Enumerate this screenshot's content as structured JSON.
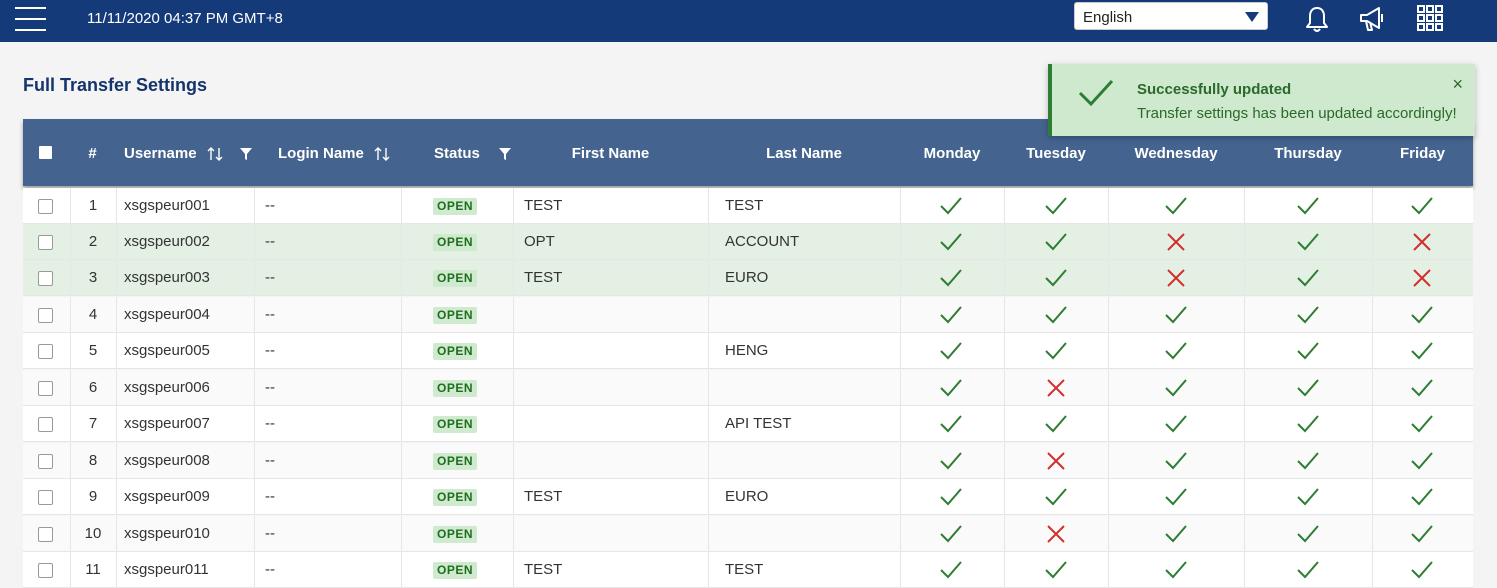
{
  "topbar": {
    "datetime": "11/11/2020 04:37 PM GMT+8",
    "language": "English",
    "icons": [
      "menu-icon",
      "bell-icon",
      "megaphone-icon",
      "apps-grid-icon"
    ]
  },
  "page": {
    "title": "Full Transfer Settings"
  },
  "toast": {
    "title": "Successfully updated",
    "message": "Transfer settings has been updated accordingly!",
    "close": "×"
  },
  "table": {
    "columns": {
      "num": "#",
      "username": "Username",
      "login_name": "Login Name",
      "status": "Status",
      "first_name": "First Name",
      "last_name": "Last Name",
      "monday": "Monday",
      "tuesday": "Tuesday",
      "wednesday": "Wednesday",
      "thursday": "Thursday",
      "friday": "Friday"
    },
    "rows": [
      {
        "num": "1",
        "username": "xsgspeur001",
        "login_name": "--",
        "status": "OPEN",
        "first_name": "TEST",
        "last_name": "TEST",
        "days": [
          true,
          true,
          true,
          true,
          true
        ],
        "highlight": false
      },
      {
        "num": "2",
        "username": "xsgspeur002",
        "login_name": "--",
        "status": "OPEN",
        "first_name": "OPT",
        "last_name": "ACCOUNT",
        "days": [
          true,
          true,
          false,
          true,
          false
        ],
        "highlight": true
      },
      {
        "num": "3",
        "username": "xsgspeur003",
        "login_name": "--",
        "status": "OPEN",
        "first_name": "TEST",
        "last_name": "EURO",
        "days": [
          true,
          true,
          false,
          true,
          false
        ],
        "highlight": true
      },
      {
        "num": "4",
        "username": "xsgspeur004",
        "login_name": "--",
        "status": "OPEN",
        "first_name": "",
        "last_name": "",
        "days": [
          true,
          true,
          true,
          true,
          true
        ],
        "highlight": false
      },
      {
        "num": "5",
        "username": "xsgspeur005",
        "login_name": "--",
        "status": "OPEN",
        "first_name": "",
        "last_name": "HENG",
        "days": [
          true,
          true,
          true,
          true,
          true
        ],
        "highlight": false
      },
      {
        "num": "6",
        "username": "xsgspeur006",
        "login_name": "--",
        "status": "OPEN",
        "first_name": "",
        "last_name": "",
        "days": [
          true,
          false,
          true,
          true,
          true
        ],
        "highlight": false
      },
      {
        "num": "7",
        "username": "xsgspeur007",
        "login_name": "--",
        "status": "OPEN",
        "first_name": "",
        "last_name": "API TEST",
        "days": [
          true,
          true,
          true,
          true,
          true
        ],
        "highlight": false
      },
      {
        "num": "8",
        "username": "xsgspeur008",
        "login_name": "--",
        "status": "OPEN",
        "first_name": "",
        "last_name": "",
        "days": [
          true,
          false,
          true,
          true,
          true
        ],
        "highlight": false
      },
      {
        "num": "9",
        "username": "xsgspeur009",
        "login_name": "--",
        "status": "OPEN",
        "first_name": "TEST",
        "last_name": "EURO",
        "days": [
          true,
          true,
          true,
          true,
          true
        ],
        "highlight": false
      },
      {
        "num": "10",
        "username": "xsgspeur010",
        "login_name": "--",
        "status": "OPEN",
        "first_name": "",
        "last_name": "",
        "days": [
          true,
          false,
          true,
          true,
          true
        ],
        "highlight": false
      },
      {
        "num": "11",
        "username": "xsgspeur011",
        "login_name": "--",
        "status": "OPEN",
        "first_name": "TEST",
        "last_name": "TEST",
        "days": [
          true,
          true,
          true,
          true,
          true
        ],
        "highlight": false
      }
    ]
  },
  "colors": {
    "topbar": "#153a7a",
    "header": "#44648f",
    "check": "#2e7d32",
    "cross": "#d32f2f",
    "highlight_row": "#e3f0e3",
    "badge_bg": "#cfeacf"
  }
}
